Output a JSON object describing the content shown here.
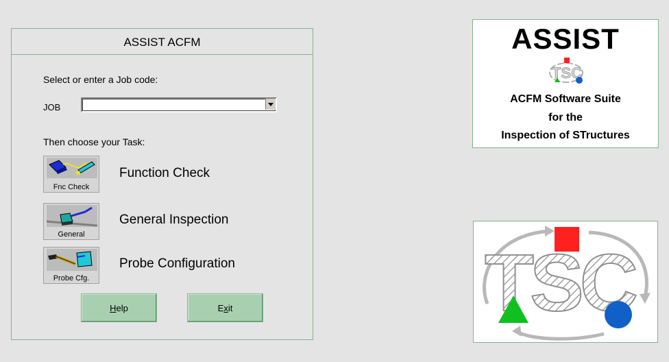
{
  "main_panel": {
    "title": "ASSIST ACFM",
    "job_prompt": "Select or enter a Job code:",
    "job_label": "JOB",
    "job_value": "",
    "task_prompt": "Then choose your Task:",
    "tasks": [
      {
        "icon_label": "Fnc Check",
        "label": "Function Check",
        "icon": "function-check-icon"
      },
      {
        "icon_label": "General",
        "label": "General Inspection",
        "icon": "general-inspection-icon"
      },
      {
        "icon_label": "Probe Cfg.",
        "label": "Probe Configuration",
        "icon": "probe-configuration-icon"
      }
    ],
    "help_button": {
      "mnemonic": "H",
      "rest": "elp"
    },
    "exit_button": {
      "before": "E",
      "mnemonic": "x",
      "rest": "it"
    }
  },
  "logo_box": {
    "title": "ASSIST",
    "subtitle_lines": [
      "ACFM Software Suite",
      "for the",
      "Inspection of STructures"
    ]
  },
  "colors": {
    "background": "#e4e4e4",
    "panel_border": "#7fb58a",
    "button_fill": "#a8d0b0",
    "logo_red": "#ff2020",
    "logo_green": "#10c020",
    "logo_blue": "#1060c8"
  }
}
